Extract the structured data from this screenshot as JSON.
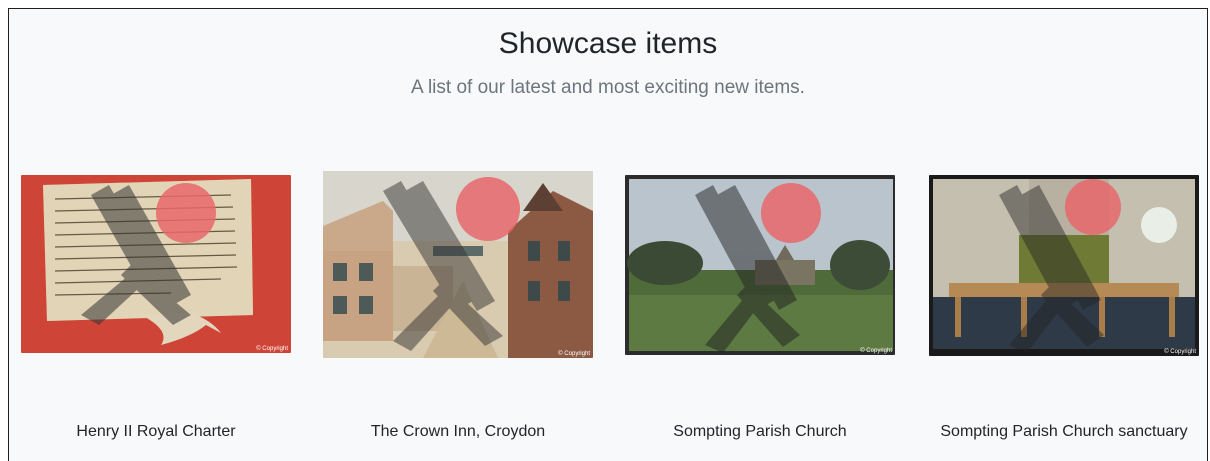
{
  "header": {
    "title": "Showcase items",
    "subtitle": "A list of our latest and most exciting new items."
  },
  "items": [
    {
      "title": "Henry II Royal Charter",
      "watermark": "© Copyright"
    },
    {
      "title": "The Crown Inn, Croydon",
      "watermark": "© Copyright"
    },
    {
      "title": "Sompting Parish Church",
      "watermark": "© Copyright"
    },
    {
      "title": "Sompting Parish Church sanctuary",
      "watermark": "© Copyright"
    }
  ],
  "colors": {
    "background": "#f8f9fa",
    "heading": "#212529",
    "subheading": "#6c757d",
    "watermark_circle": "#e8676b"
  }
}
